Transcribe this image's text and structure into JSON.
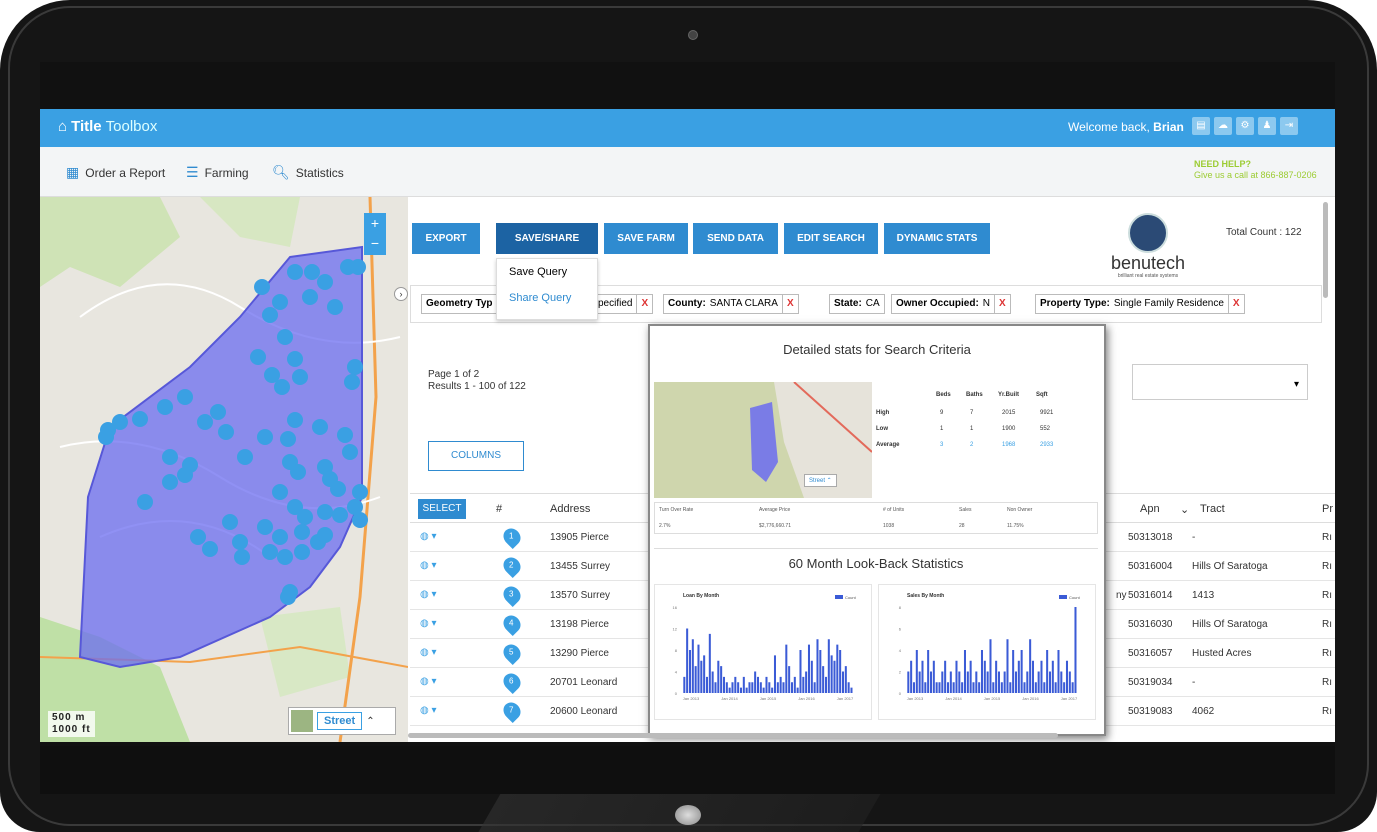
{
  "app": {
    "brand_main": "Title",
    "brand_sub": "Toolbox",
    "welcome_prefix": "Welcome back,",
    "user": "Brian"
  },
  "nav": {
    "items": [
      "Order a Report",
      "Farming",
      "Statistics"
    ]
  },
  "help": {
    "title": "NEED HELP?",
    "text": "Give us a call at 866-887-0206"
  },
  "toolbar": {
    "buttons": [
      "EXPORT",
      "SAVE/SHARE",
      "SAVE FARM",
      "SEND DATA",
      "EDIT SEARCH",
      "DYNAMIC STATS"
    ]
  },
  "save_menu": {
    "items": [
      "Save Query",
      "Share Query"
    ]
  },
  "filters": [
    {
      "label": "Geometry Typ",
      "value": ""
    },
    {
      "label": "",
      "value": "pecified"
    },
    {
      "label": "County:",
      "value": "SANTA CLARA"
    },
    {
      "label": "State:",
      "value": "CA"
    },
    {
      "label": "Owner Occupied:",
      "value": "N"
    },
    {
      "label": "Property Type:",
      "value": "Single Family Residence"
    }
  ],
  "brand_logo": {
    "word": "benutech",
    "tagline": "brilliant real estate systems"
  },
  "total_count": "Total Count : 122",
  "pagination": {
    "page": "Page 1 of 2",
    "results": "Results 1 - 100 of 122"
  },
  "columns_button": "COLUMNS",
  "table": {
    "select_label": "SELECT",
    "headers": [
      "#",
      "Address",
      "Apn",
      "Tract",
      "Pr"
    ],
    "rows": [
      {
        "n": "1",
        "address": "13905 Pierce",
        "apn": "50313018",
        "tract": "-",
        "pr": "Rı"
      },
      {
        "n": "2",
        "address": "13455 Surrey",
        "apn": "50316004",
        "tract": "Hills Of Saratoga",
        "pr": "Rı"
      },
      {
        "n": "3",
        "address": "13570 Surrey",
        "apn": "50316014",
        "tract": "1413",
        "pr": "Rı",
        "extra": "ny"
      },
      {
        "n": "4",
        "address": "13198 Pierce",
        "apn": "50316030",
        "tract": "Hills Of Saratoga",
        "pr": "Rı"
      },
      {
        "n": "5",
        "address": "13290 Pierce",
        "apn": "50316057",
        "tract": "Husted Acres",
        "pr": "Rı"
      },
      {
        "n": "6",
        "address": "20701 Leonard",
        "apn": "50319034",
        "tract": "-",
        "pr": "Rı"
      },
      {
        "n": "7",
        "address": "20600 Leonard",
        "apn": "50319083",
        "tract": "4062",
        "pr": "Rı"
      }
    ]
  },
  "map": {
    "scale_m": "500 m",
    "scale_ft": "1000 ft",
    "street_label": "Street",
    "zoom_in": "+",
    "zoom_out": "−"
  },
  "modal": {
    "title": "Detailed stats for Search Criteria",
    "minimap_street": "Street",
    "stats_headers": [
      "Beds",
      "Baths",
      "Yr.Built",
      "Sqft"
    ],
    "stats_rows": [
      {
        "label": "High",
        "values": [
          "9",
          "7",
          "2015",
          "9921"
        ]
      },
      {
        "label": "Low",
        "values": [
          "1",
          "1",
          "1900",
          "552"
        ]
      },
      {
        "label": "Average",
        "values": [
          "3",
          "2",
          "1968",
          "2933"
        ]
      }
    ],
    "summary_headers": [
      "Turn Over Rate",
      "Average Price",
      "# of Units",
      "Sales",
      "Non Owner"
    ],
    "summary_values": [
      "2.7%",
      "$2,776,660.71",
      "1038",
      "28",
      "11.75%"
    ],
    "lookback_title": "60 Month Look-Back Statistics"
  },
  "chart_data": [
    {
      "type": "bar",
      "title": "Loan By Month",
      "legend": "Count",
      "ylim": [
        0,
        16
      ],
      "yticks": [
        "16",
        "12",
        "8",
        "4",
        "0"
      ],
      "xticks": [
        "Jan 2013",
        "Jan 2014",
        "Jan 2015",
        "Jan 2016",
        "Jan 2017"
      ],
      "values": [
        3,
        12,
        8,
        10,
        5,
        9,
        6,
        7,
        3,
        11,
        4,
        2,
        6,
        5,
        3,
        2,
        1,
        2,
        3,
        2,
        1,
        3,
        1,
        2,
        2,
        4,
        3,
        2,
        1,
        3,
        2,
        1,
        7,
        2,
        3,
        2,
        9,
        5,
        2,
        3,
        1,
        8,
        3,
        4,
        9,
        6,
        2,
        10,
        8,
        5,
        3,
        10,
        7,
        6,
        9,
        8,
        4,
        5,
        2,
        1
      ]
    },
    {
      "type": "bar",
      "title": "Sales By Month",
      "legend": "Count",
      "ylim": [
        0,
        8
      ],
      "yticks": [
        "8",
        "6",
        "4",
        "2",
        "0"
      ],
      "xticks": [
        "Jan 2013",
        "Jan 2014",
        "Jan 2015",
        "Jan 2016",
        "Jan 2017"
      ],
      "values": [
        2,
        3,
        1,
        4,
        2,
        3,
        1,
        4,
        2,
        3,
        1,
        1,
        2,
        3,
        1,
        2,
        1,
        3,
        2,
        1,
        4,
        2,
        3,
        1,
        2,
        1,
        4,
        3,
        2,
        5,
        1,
        3,
        2,
        1,
        2,
        5,
        1,
        4,
        2,
        3,
        4,
        1,
        2,
        5,
        3,
        1,
        2,
        3,
        1,
        4,
        2,
        3,
        1,
        4,
        2,
        1,
        3,
        2,
        1,
        8
      ]
    }
  ],
  "colors": {
    "brand_blue": "#3aa0e3",
    "dark_blue": "#1c63a3",
    "bar_blue": "#3b5bd6",
    "polygon": "#6b6cf0",
    "help_green": "#9ccc32"
  }
}
